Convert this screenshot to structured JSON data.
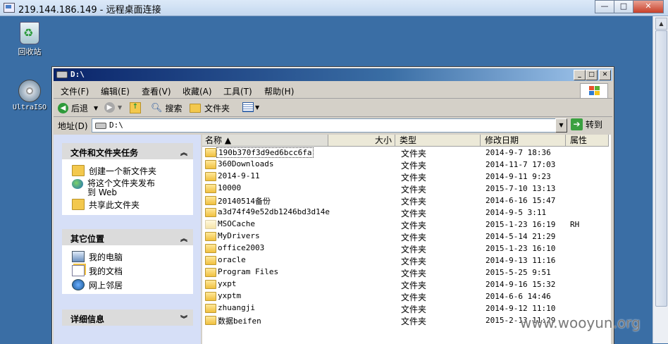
{
  "rdp": {
    "title": "219.144.186.149 - 远程桌面连接",
    "ctrl_min": "—",
    "ctrl_max": "□",
    "ctrl_close": "✕"
  },
  "desktop": {
    "icons": [
      {
        "label": "回收站",
        "icon": "recycle-bin-icon"
      },
      {
        "label": "UltraISO",
        "icon": "ultraiso-icon"
      }
    ]
  },
  "explorer": {
    "title": "D:\\",
    "menu": [
      "文件(F)",
      "编辑(E)",
      "查看(V)",
      "收藏(A)",
      "工具(T)",
      "帮助(H)"
    ],
    "toolbar": {
      "back": "后退",
      "search": "搜索",
      "folders": "文件夹"
    },
    "address": {
      "label": "地址(D)",
      "value": "D:\\",
      "go": "转到"
    },
    "tasks": {
      "file_tasks": {
        "title": "文件和文件夹任务",
        "items": [
          "创建一个新文件夹",
          "将这个文件夹发布到 Web",
          "共享此文件夹"
        ]
      },
      "other_places": {
        "title": "其它位置",
        "items": [
          "我的电脑",
          "我的文档",
          "网上邻居"
        ]
      },
      "details": {
        "title": "详细信息"
      }
    },
    "columns": {
      "name": "名称 ▲",
      "size": "大小",
      "type": "类型",
      "modified": "修改日期",
      "attr": "属性"
    },
    "files": [
      {
        "name": "190b370f3d9ed6bcc6fa",
        "type": "文件夹",
        "modified": "2014-9-7 18:36",
        "attr": ""
      },
      {
        "name": "360Downloads",
        "type": "文件夹",
        "modified": "2014-11-7 17:03",
        "attr": ""
      },
      {
        "name": "2014-9-11",
        "type": "文件夹",
        "modified": "2014-9-11 9:23",
        "attr": ""
      },
      {
        "name": "10000",
        "type": "文件夹",
        "modified": "2015-7-10 13:13",
        "attr": ""
      },
      {
        "name": "20140514备份",
        "type": "文件夹",
        "modified": "2014-6-16 15:47",
        "attr": ""
      },
      {
        "name": "a3d74f49e52db1246bd3d14e",
        "type": "文件夹",
        "modified": "2014-9-5 3:11",
        "attr": ""
      },
      {
        "name": "MSOCache",
        "type": "文件夹",
        "modified": "2015-1-23 16:19",
        "attr": "RH"
      },
      {
        "name": "MyDrivers",
        "type": "文件夹",
        "modified": "2014-5-14 21:29",
        "attr": ""
      },
      {
        "name": "office2003",
        "type": "文件夹",
        "modified": "2015-1-23 16:10",
        "attr": ""
      },
      {
        "name": "oracle",
        "type": "文件夹",
        "modified": "2014-9-13 11:16",
        "attr": ""
      },
      {
        "name": "Program Files",
        "type": "文件夹",
        "modified": "2015-5-25 9:51",
        "attr": ""
      },
      {
        "name": "yxpt",
        "type": "文件夹",
        "modified": "2014-9-16 15:32",
        "attr": ""
      },
      {
        "name": "yxptm",
        "type": "文件夹",
        "modified": "2014-6-6 14:46",
        "attr": ""
      },
      {
        "name": "zhuangji",
        "type": "文件夹",
        "modified": "2014-9-12 11:10",
        "attr": ""
      },
      {
        "name": "数据beifen",
        "type": "文件夹",
        "modified": "2015-2-13 11:29",
        "attr": ""
      }
    ]
  },
  "watermark": "www.wooyun.org"
}
